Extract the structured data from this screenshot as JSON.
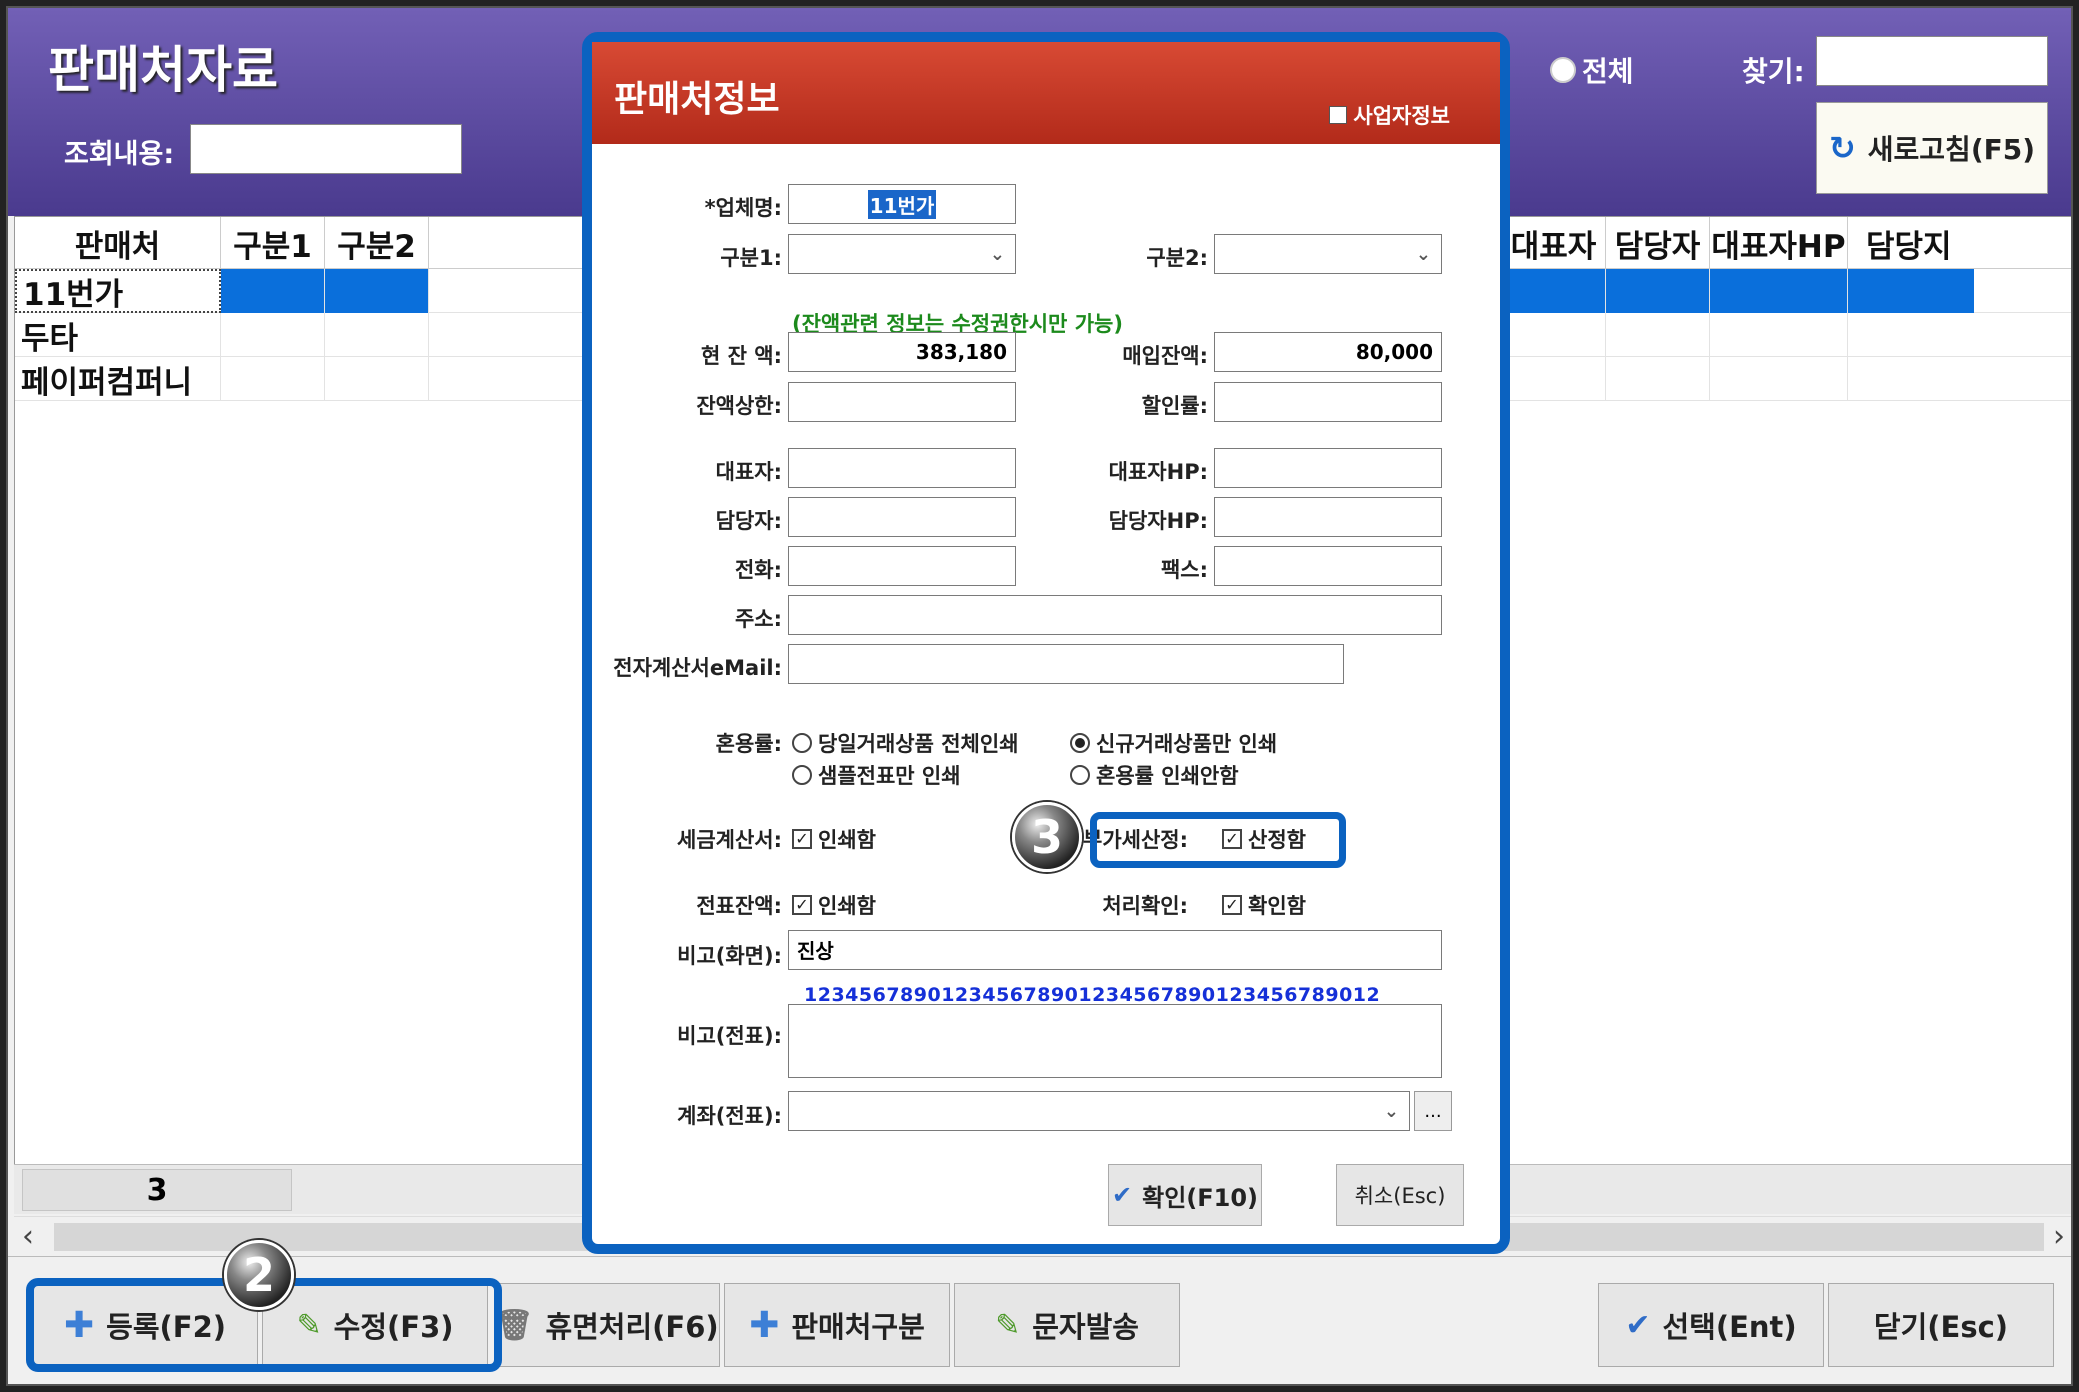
{
  "app": {
    "title": "판매처자료",
    "search_label": "조회내용:",
    "search_value": "",
    "radio_all_label": "전체",
    "find_label": "찾기:",
    "find_value": "",
    "refresh_label": "새로고침(F5)"
  },
  "grid": {
    "columns_left": [
      "판매처",
      "구분1",
      "구분2"
    ],
    "columns_right": [
      "대표자",
      "담당자",
      "대표자HP",
      "담당지"
    ],
    "rows": [
      "11번가",
      "두타",
      "페이퍼컴퍼니"
    ],
    "count": "3"
  },
  "toolbar": {
    "register": "등록(F2)",
    "edit": "수정(F3)",
    "dormant": "휴면처리(F6)",
    "category": "판매처구분",
    "sms": "문자발송",
    "select": "선택(Ent)",
    "close": "닫기(Esc)"
  },
  "badges": {
    "two": "2",
    "three": "3"
  },
  "dialog": {
    "title": "판매처정보",
    "biz_info_label": "사업자정보",
    "company_label": "*업체명:",
    "company_value": "11번가",
    "cat1_label": "구분1:",
    "cat1_value": "",
    "cat2_label": "구분2:",
    "cat2_value": "",
    "balance_note": "(잔액관련 정보는 수정권한시만 가능)",
    "balance_label": "현 잔 액:",
    "balance_value": "383,180",
    "purchase_balance_label": "매입잔액:",
    "purchase_balance_value": "80,000",
    "limit_label": "잔액상한:",
    "limit_value": "",
    "discount_label": "할인률:",
    "discount_value": "",
    "ceo_label": "대표자:",
    "ceo_value": "",
    "ceo_hp_label": "대표자HP:",
    "ceo_hp_value": "",
    "manager_label": "담당자:",
    "manager_value": "",
    "manager_hp_label": "담당자HP:",
    "manager_hp_value": "",
    "phone_label": "전화:",
    "phone_value": "",
    "fax_label": "팩스:",
    "fax_value": "",
    "address_label": "주소:",
    "address_value": "",
    "email_label": "전자계산서eMail:",
    "email_value": "",
    "mix_label": "혼용률:",
    "mix_opt1": "당일거래상품 전체인쇄",
    "mix_opt2": "신규거래상품만 인쇄",
    "mix_opt3": "샘플전표만 인쇄",
    "mix_opt4": "혼용률 인쇄안함",
    "tax_invoice_label": "세금계산서:",
    "tax_invoice_check": "인쇄함",
    "vat_label": "부가세산정:",
    "vat_check": "산정함",
    "slip_balance_label": "전표잔액:",
    "slip_balance_check": "인쇄함",
    "process_label": "처리확인:",
    "process_check": "확인함",
    "memo_screen_label": "비고(화면):",
    "memo_screen_value": "진상",
    "digits_ruler": "1234567890123456789012345678901234567890​12",
    "memo_slip_label": "비고(전표):",
    "memo_slip_value": "",
    "account_label": "계좌(전표):",
    "account_value": "",
    "account_more": "...",
    "ok_button": "확인(F10)",
    "cancel_button": "취소(Esc)"
  },
  "icons": {
    "refresh": "refresh-icon",
    "plus": "plus-icon",
    "pencil": "pencil-icon",
    "trash": "trash-icon",
    "check": "check-icon",
    "chevron": "chevron-down-icon"
  }
}
